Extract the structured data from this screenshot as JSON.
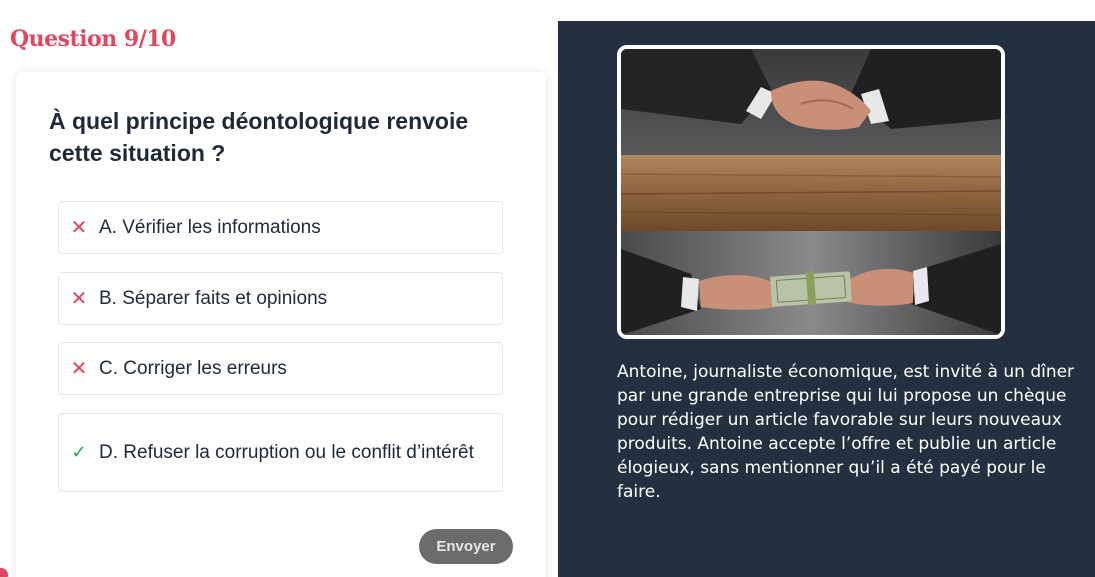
{
  "header": {
    "question_counter": "Question 9/10"
  },
  "quiz": {
    "question": "À quel principe déontologique renvoie cette situation ?",
    "options": [
      {
        "label": "A. Vérifier les informations",
        "status": "wrong",
        "icon": "cross-icon"
      },
      {
        "label": "B. Séparer faits et opinions",
        "status": "wrong",
        "icon": "cross-icon"
      },
      {
        "label": "C. Corriger les erreurs",
        "status": "wrong",
        "icon": "cross-icon"
      },
      {
        "label": "D. Refuser la corruption ou le conflit d’intérêt",
        "status": "correct",
        "icon": "check-icon"
      }
    ],
    "submit_label": "Envoyer"
  },
  "scenario": {
    "image_icon": "handshake-bribe-photo",
    "text": "Antoine, journaliste économique, est invité à un dîner par une grande entreprise qui lui propose un chèque pour rédiger un article favorable sur leurs nouveaux produits. Antoine accepte l’offre et publie un article élogieux, sans mentionner qu’il a été payé pour le faire."
  },
  "colors": {
    "accent": "#e0485f",
    "correct": "#22a05b",
    "panel": "#243040",
    "button": "#6b6b6b"
  }
}
